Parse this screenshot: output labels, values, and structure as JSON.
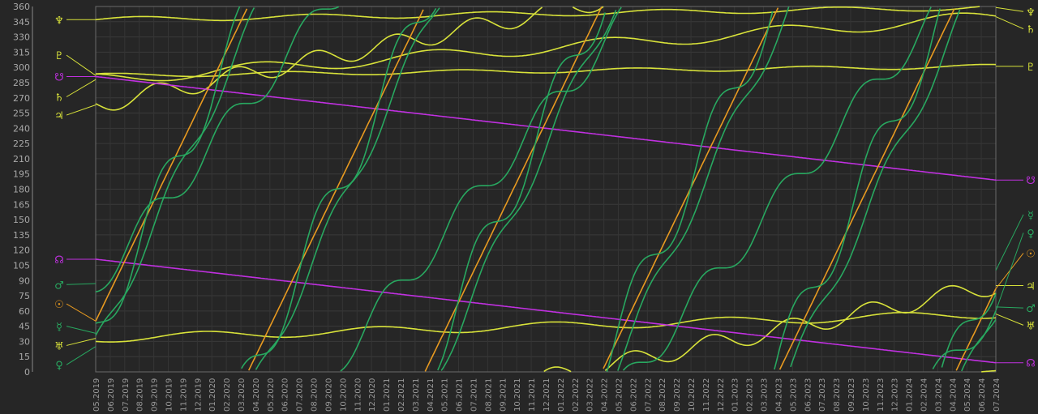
{
  "chart_data": {
    "type": "line",
    "title": "",
    "xlabel": "",
    "ylabel": "",
    "x_ticks": [
      "05.2019",
      "06.2019",
      "07.2019",
      "08.2019",
      "09.2019",
      "10.2019",
      "11.2019",
      "12.2019",
      "01.2020",
      "02.2020",
      "03.2020",
      "04.2020",
      "05.2020",
      "06.2020",
      "07.2020",
      "08.2020",
      "09.2020",
      "10.2020",
      "11.2020",
      "12.2020",
      "01.2021",
      "02.2021",
      "03.2021",
      "04.2021",
      "05.2021",
      "06.2021",
      "07.2021",
      "08.2021",
      "09.2021",
      "10.2021",
      "11.2021",
      "12.2021",
      "01.2022",
      "02.2022",
      "03.2022",
      "04.2022",
      "05.2022",
      "06.2022",
      "07.2022",
      "08.2022",
      "09.2022",
      "10.2022",
      "11.2022",
      "12.2022",
      "01.2023",
      "02.2023",
      "03.2023",
      "04.2023",
      "05.2023",
      "06.2023",
      "07.2023",
      "08.2023",
      "09.2023",
      "10.2023",
      "11.2023",
      "12.2023",
      "01.2024",
      "02.2024",
      "03.2024",
      "04.2024",
      "05.2024",
      "06.2024",
      "07.2024"
    ],
    "y_ticks": [
      0,
      15,
      30,
      45,
      60,
      75,
      90,
      105,
      120,
      135,
      150,
      165,
      180,
      195,
      210,
      225,
      240,
      255,
      270,
      285,
      300,
      315,
      330,
      345,
      360
    ],
    "ylim": [
      0,
      360
    ],
    "grid": true,
    "series": [
      {
        "glyph": "♆",
        "color": "#d8e23a",
        "kind": "slow",
        "start": 347,
        "end": 359,
        "amp": 2.5,
        "start_label": 347,
        "end_label": 355
      },
      {
        "glyph": "♇",
        "color": "#d8e23a",
        "kind": "slow",
        "start": 292,
        "end": 301,
        "amp": 2,
        "start_label": 312,
        "end_label": 301
      },
      {
        "glyph": "♄",
        "color": "#d8e23a",
        "kind": "slow",
        "start": 288,
        "end": 350,
        "amp": 6,
        "start_label": 271,
        "end_label": 338
      },
      {
        "glyph": "♃",
        "color": "#d8e23a",
        "kind": "wrap",
        "start": 263,
        "end": 445,
        "amp": 9,
        "start_label": 253,
        "end_label": 85
      },
      {
        "glyph": "♅",
        "color": "#d8e23a",
        "kind": "slow",
        "start": 33,
        "end": 57,
        "amp": 4,
        "start_label": 26,
        "end_label": 46
      },
      {
        "glyph": "☊",
        "color": "#c030e0",
        "kind": "linear",
        "start": 111,
        "end": 9,
        "amp": 0,
        "start_label": 111,
        "end_label": 9
      },
      {
        "glyph": "☋",
        "color": "#c030e0",
        "kind": "linear",
        "start": 291,
        "end": 189,
        "amp": 0,
        "start_label": 291,
        "end_label": 189
      },
      {
        "glyph": "☉",
        "color": "#e89a20",
        "kind": "wrap",
        "start": 50,
        "end": 1882,
        "amp": 0,
        "start_label": 67,
        "end_label": 117
      },
      {
        "glyph": "♀",
        "color": "#28a860",
        "kind": "wrap",
        "start": 25,
        "end": 1860,
        "amp": 11,
        "start_label": 7,
        "end_label": 137
      },
      {
        "glyph": "☿",
        "color": "#28a860",
        "kind": "wrap",
        "start": 38,
        "end": 1900,
        "amp": 24,
        "start_label": 45,
        "end_label": 155
      },
      {
        "glyph": "♂",
        "color": "#28a860",
        "kind": "wrap",
        "start": 87,
        "end": 1144,
        "amp": 15,
        "start_label": 86,
        "end_label": 63
      }
    ]
  }
}
